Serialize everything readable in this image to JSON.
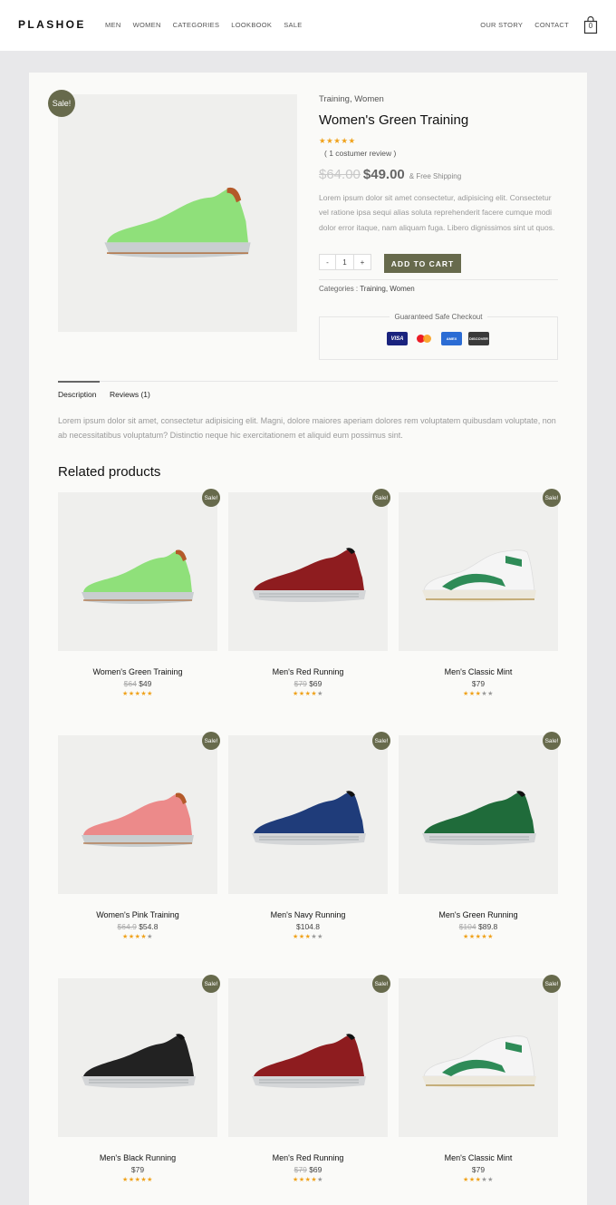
{
  "header": {
    "logo": "PLASHOE",
    "nav_left": [
      "MEN",
      "WOMEN",
      "CATEGORIES",
      "LOOKBOOK",
      "SALE"
    ],
    "nav_right": [
      "OUR STORY",
      "CONTACT"
    ],
    "cart_count": "0"
  },
  "product": {
    "sale_label": "Sale!",
    "categories": "Training, Women",
    "title": "Women's Green Training",
    "rating": 5,
    "review_count": "( 1 costumer review )",
    "old_price": "$64.00",
    "new_price": "$49.00",
    "shipping": "& Free Shipping",
    "description": "Lorem ipsum dolor sit amet consectetur, adipisicing elit. Consectetur vel ratione ipsa sequi alias soluta reprehenderit facere cumque modi dolor error itaque, nam aliquam fuga. Libero dignissimos sint ut quos.",
    "quantity": "1",
    "minus_label": "-",
    "plus_label": "+",
    "add_to_cart": "ADD TO CART",
    "categories_label": "Categories :",
    "categories_value": "Training, Women",
    "checkout_label": "Guaranteed Safe Checkout",
    "payment_icons": [
      "visa",
      "mastercard",
      "american-express",
      "discover"
    ],
    "shoe_color": "#8fe07a"
  },
  "tabs": {
    "description": "Description",
    "reviews": "Reviews (1)",
    "description_text": "Lorem ipsum dolor sit amet, consectetur adipisicing elit. Magni, dolore maiores aperiam dolores rem voluptatem quibusdam voluptate, non ab necessitatibus voluptatum? Distinctio neque hic exercitationem et aliquid eum possimus sint."
  },
  "related": {
    "title": "Related products",
    "sale_label": "Sale!",
    "products": [
      {
        "name": "Women's Green Training",
        "old_price": "$64",
        "price": "$49",
        "rating": 5,
        "color": "#8fe07a",
        "style": "knit"
      },
      {
        "name": "Men's Red Running",
        "old_price": "$79",
        "price": "$69",
        "rating": 4,
        "color": "#8e1c1f",
        "style": "runner"
      },
      {
        "name": "Men's Classic Mint",
        "old_price": "",
        "price": "$79",
        "rating": 3,
        "color": "#2e8b57",
        "style": "classic"
      },
      {
        "name": "Women's Pink Training",
        "old_price": "$64.9",
        "price": "$54.8",
        "rating": 4,
        "color": "#ec8a8a",
        "style": "knit"
      },
      {
        "name": "Men's Navy Running",
        "old_price": "",
        "price": "$104.8",
        "rating": 3,
        "color": "#1f3c7a",
        "style": "runner"
      },
      {
        "name": "Men's Green Running",
        "old_price": "$104",
        "price": "$89.8",
        "rating": 5,
        "color": "#1f6b3a",
        "style": "runner"
      },
      {
        "name": "Men's Black Running",
        "old_price": "",
        "price": "$79",
        "rating": 5,
        "color": "#222222",
        "style": "runner"
      },
      {
        "name": "Men's Red Running",
        "old_price": "$79",
        "price": "$69",
        "rating": 4,
        "color": "#8e1c1f",
        "style": "runner"
      },
      {
        "name": "Men's Classic Mint",
        "old_price": "",
        "price": "$79",
        "rating": 3,
        "color": "#2e8b57",
        "style": "classic"
      }
    ]
  }
}
